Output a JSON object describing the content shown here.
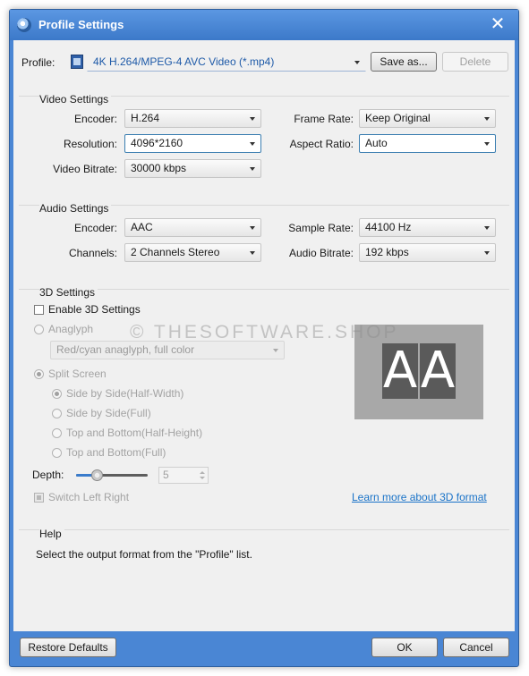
{
  "window": {
    "title": "Profile Settings",
    "close_glyph": "✕",
    "app_icon": "app-logo-icon"
  },
  "profile": {
    "label": "Profile:",
    "value": "4K H.264/MPEG-4 AVC Video (*.mp4)",
    "save_as": "Save as...",
    "delete": "Delete"
  },
  "video": {
    "heading": "Video Settings",
    "encoder_label": "Encoder:",
    "encoder": "H.264",
    "resolution_label": "Resolution:",
    "resolution": "4096*2160",
    "bitrate_label": "Video Bitrate:",
    "bitrate": "30000 kbps",
    "framerate_label": "Frame Rate:",
    "framerate": "Keep Original",
    "aspect_label": "Aspect Ratio:",
    "aspect": "Auto"
  },
  "audio": {
    "heading": "Audio Settings",
    "encoder_label": "Encoder:",
    "encoder": "AAC",
    "channels_label": "Channels:",
    "channels": "2 Channels Stereo",
    "samplerate_label": "Sample Rate:",
    "samplerate": "44100 Hz",
    "bitrate_label": "Audio Bitrate:",
    "bitrate": "192 kbps"
  },
  "threed": {
    "heading": "3D Settings",
    "enable": "Enable 3D Settings",
    "anaglyph": "Anaglyph",
    "anaglyph_mode": "Red/cyan anaglyph, full color",
    "split_screen": "Split Screen",
    "side_half": "Side by Side(Half-Width)",
    "side_full": "Side by Side(Full)",
    "top_half": "Top and Bottom(Half-Height)",
    "top_full": "Top and Bottom(Full)",
    "depth_label": "Depth:",
    "depth": "5",
    "depth_level": 0.3,
    "switch": "Switch Left Right",
    "learn_more": "Learn more about 3D format",
    "preview_letters": [
      "A",
      "A"
    ]
  },
  "help": {
    "heading": "Help",
    "text": "Select the output format from the \"Profile\" list."
  },
  "footer": {
    "restore": "Restore Defaults",
    "ok": "OK",
    "cancel": "Cancel"
  },
  "watermark": "© THESOFTWARE.SHOP",
  "colors": {
    "titlebar": "#4a86d4",
    "link": "#1a73c8",
    "dialog_bg": "#f0f0f0"
  }
}
